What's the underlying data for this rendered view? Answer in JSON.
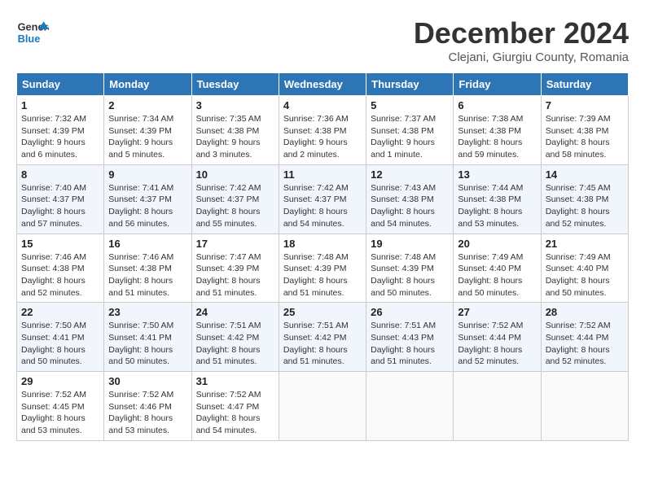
{
  "header": {
    "logo_line1": "General",
    "logo_line2": "Blue",
    "month_title": "December 2024",
    "subtitle": "Clejani, Giurgiu County, Romania"
  },
  "days_of_week": [
    "Sunday",
    "Monday",
    "Tuesday",
    "Wednesday",
    "Thursday",
    "Friday",
    "Saturday"
  ],
  "weeks": [
    [
      {
        "day": "1",
        "sunrise": "7:32 AM",
        "sunset": "4:39 PM",
        "daylight": "9 hours and 6 minutes."
      },
      {
        "day": "2",
        "sunrise": "7:34 AM",
        "sunset": "4:39 PM",
        "daylight": "9 hours and 5 minutes."
      },
      {
        "day": "3",
        "sunrise": "7:35 AM",
        "sunset": "4:38 PM",
        "daylight": "9 hours and 3 minutes."
      },
      {
        "day": "4",
        "sunrise": "7:36 AM",
        "sunset": "4:38 PM",
        "daylight": "9 hours and 2 minutes."
      },
      {
        "day": "5",
        "sunrise": "7:37 AM",
        "sunset": "4:38 PM",
        "daylight": "9 hours and 1 minute."
      },
      {
        "day": "6",
        "sunrise": "7:38 AM",
        "sunset": "4:38 PM",
        "daylight": "8 hours and 59 minutes."
      },
      {
        "day": "7",
        "sunrise": "7:39 AM",
        "sunset": "4:38 PM",
        "daylight": "8 hours and 58 minutes."
      }
    ],
    [
      {
        "day": "8",
        "sunrise": "7:40 AM",
        "sunset": "4:37 PM",
        "daylight": "8 hours and 57 minutes."
      },
      {
        "day": "9",
        "sunrise": "7:41 AM",
        "sunset": "4:37 PM",
        "daylight": "8 hours and 56 minutes."
      },
      {
        "day": "10",
        "sunrise": "7:42 AM",
        "sunset": "4:37 PM",
        "daylight": "8 hours and 55 minutes."
      },
      {
        "day": "11",
        "sunrise": "7:42 AM",
        "sunset": "4:37 PM",
        "daylight": "8 hours and 54 minutes."
      },
      {
        "day": "12",
        "sunrise": "7:43 AM",
        "sunset": "4:38 PM",
        "daylight": "8 hours and 54 minutes."
      },
      {
        "day": "13",
        "sunrise": "7:44 AM",
        "sunset": "4:38 PM",
        "daylight": "8 hours and 53 minutes."
      },
      {
        "day": "14",
        "sunrise": "7:45 AM",
        "sunset": "4:38 PM",
        "daylight": "8 hours and 52 minutes."
      }
    ],
    [
      {
        "day": "15",
        "sunrise": "7:46 AM",
        "sunset": "4:38 PM",
        "daylight": "8 hours and 52 minutes."
      },
      {
        "day": "16",
        "sunrise": "7:46 AM",
        "sunset": "4:38 PM",
        "daylight": "8 hours and 51 minutes."
      },
      {
        "day": "17",
        "sunrise": "7:47 AM",
        "sunset": "4:39 PM",
        "daylight": "8 hours and 51 minutes."
      },
      {
        "day": "18",
        "sunrise": "7:48 AM",
        "sunset": "4:39 PM",
        "daylight": "8 hours and 51 minutes."
      },
      {
        "day": "19",
        "sunrise": "7:48 AM",
        "sunset": "4:39 PM",
        "daylight": "8 hours and 50 minutes."
      },
      {
        "day": "20",
        "sunrise": "7:49 AM",
        "sunset": "4:40 PM",
        "daylight": "8 hours and 50 minutes."
      },
      {
        "day": "21",
        "sunrise": "7:49 AM",
        "sunset": "4:40 PM",
        "daylight": "8 hours and 50 minutes."
      }
    ],
    [
      {
        "day": "22",
        "sunrise": "7:50 AM",
        "sunset": "4:41 PM",
        "daylight": "8 hours and 50 minutes."
      },
      {
        "day": "23",
        "sunrise": "7:50 AM",
        "sunset": "4:41 PM",
        "daylight": "8 hours and 50 minutes."
      },
      {
        "day": "24",
        "sunrise": "7:51 AM",
        "sunset": "4:42 PM",
        "daylight": "8 hours and 51 minutes."
      },
      {
        "day": "25",
        "sunrise": "7:51 AM",
        "sunset": "4:42 PM",
        "daylight": "8 hours and 51 minutes."
      },
      {
        "day": "26",
        "sunrise": "7:51 AM",
        "sunset": "4:43 PM",
        "daylight": "8 hours and 51 minutes."
      },
      {
        "day": "27",
        "sunrise": "7:52 AM",
        "sunset": "4:44 PM",
        "daylight": "8 hours and 52 minutes."
      },
      {
        "day": "28",
        "sunrise": "7:52 AM",
        "sunset": "4:44 PM",
        "daylight": "8 hours and 52 minutes."
      }
    ],
    [
      {
        "day": "29",
        "sunrise": "7:52 AM",
        "sunset": "4:45 PM",
        "daylight": "8 hours and 53 minutes."
      },
      {
        "day": "30",
        "sunrise": "7:52 AM",
        "sunset": "4:46 PM",
        "daylight": "8 hours and 53 minutes."
      },
      {
        "day": "31",
        "sunrise": "7:52 AM",
        "sunset": "4:47 PM",
        "daylight": "8 hours and 54 minutes."
      },
      null,
      null,
      null,
      null
    ]
  ],
  "labels": {
    "sunrise": "Sunrise:",
    "sunset": "Sunset:",
    "daylight": "Daylight:"
  }
}
